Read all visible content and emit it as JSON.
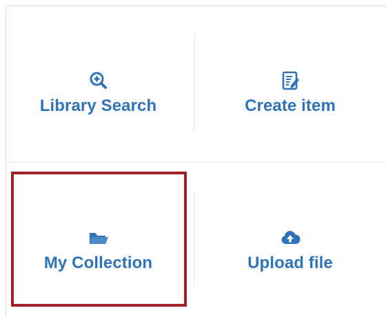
{
  "tiles": {
    "library_search": {
      "label": "Library Search",
      "icon": "search-plus-icon"
    },
    "create_item": {
      "label": "Create item",
      "icon": "edit-document-icon"
    },
    "my_collection": {
      "label": "My Collection",
      "icon": "folder-open-icon"
    },
    "upload_file": {
      "label": "Upload file",
      "icon": "cloud-upload-icon"
    }
  },
  "colors": {
    "accent": "#2f73b8",
    "highlight": "#a51e2b",
    "divider": "#e1e4e8"
  }
}
